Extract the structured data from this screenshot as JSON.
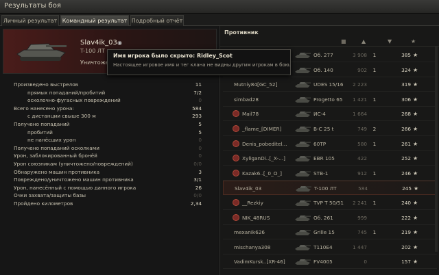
{
  "window": {
    "title": "Результаты боя"
  },
  "tabs": [
    {
      "label": "Личный результат"
    },
    {
      "label": "Командный результат"
    },
    {
      "label": "Подробный отчёт"
    }
  ],
  "player": {
    "name": "Slav4ik_03",
    "vehicle": "T-100 ЛТ",
    "status": "Уничтожен"
  },
  "tooltip": {
    "title": "Имя игрока было скрыто: Ridley_Scot",
    "body": "Настоящее игровое имя и тег клана не видны другим игрокам в бою."
  },
  "stats": [
    {
      "label": "Произведено выстрелов",
      "value": "11"
    },
    {
      "label": "прямых попаданий/пробитий",
      "value": "7/2"
    },
    {
      "label": "осколочно-фугасных повреждений",
      "value": "0"
    },
    {
      "label": "Всего нанесено урона:",
      "value": "584"
    },
    {
      "label": "с дистанции свыше 300 м",
      "value": "293"
    },
    {
      "label": "Получено попаданий",
      "value": "5"
    },
    {
      "label": "пробитий",
      "value": "5"
    },
    {
      "label": "не нанёсших урон",
      "value": "0"
    },
    {
      "label": "Получено попаданий осколками",
      "value": "0"
    },
    {
      "label": "Урон, заблокированный бронёй",
      "value": "0"
    },
    {
      "label": "Урон союзникам (уничтожено/повреждений)",
      "value": "0/0"
    },
    {
      "label": "Обнаружено машин противника",
      "value": "3"
    },
    {
      "label": "Повреждено/уничтожено машин противника",
      "value": "3/1"
    },
    {
      "label": "Урон, нанесённый с помощью данного игрока",
      "value": "26"
    },
    {
      "label": "Очки захвата/защиты базы",
      "value": "0/0"
    },
    {
      "label": "Пройдено километров",
      "value": "2,34"
    }
  ],
  "enemies": {
    "header": "Противник",
    "rows": [
      {
        "name": "",
        "vehicle": "Об. 277",
        "damage": "3 908",
        "kills": "1",
        "xp": "385",
        "icon": false
      },
      {
        "name": "",
        "vehicle": "Об. 140",
        "damage": "902",
        "kills": "1",
        "xp": "324",
        "icon": false
      },
      {
        "name": "Mutniy84[GC_52]",
        "vehicle": "UDES 15/16",
        "damage": "2 223",
        "kills": "",
        "xp": "319",
        "icon": false
      },
      {
        "name": "simbad28",
        "vehicle": "Progetto 65",
        "damage": "1 421",
        "kills": "1",
        "xp": "306",
        "icon": false
      },
      {
        "name": "Mail78",
        "vehicle": "ИС-4",
        "damage": "1 664",
        "kills": "",
        "xp": "268",
        "icon": true
      },
      {
        "name": "_flame_[DIMER]",
        "vehicle": "B-C 25 t",
        "damage": "749",
        "kills": "2",
        "xp": "266",
        "icon": true
      },
      {
        "name": "Denis_pobeditel...",
        "vehicle": "60TP",
        "damage": "580",
        "kills": "1",
        "xp": "261",
        "icon": true
      },
      {
        "name": "XyliganDi..[_X-...]",
        "vehicle": "EBR 105",
        "damage": "422",
        "kills": "",
        "xp": "252",
        "icon": true
      },
      {
        "name": "Kazak6..[_0_O_]",
        "vehicle": "STB-1",
        "damage": "912",
        "kills": "1",
        "xp": "246",
        "icon": true
      },
      {
        "name": "Slav4ik_03",
        "vehicle": "T-100 ЛТ",
        "damage": "584",
        "kills": "",
        "xp": "245",
        "icon": false,
        "self": true
      },
      {
        "name": "__Rezkiy",
        "vehicle": "TVP T 50/51",
        "damage": "2 241",
        "kills": "1",
        "xp": "240",
        "icon": true
      },
      {
        "name": "NIK_48RUS",
        "vehicle": "Об. 261",
        "damage": "999",
        "kills": "",
        "xp": "222",
        "icon": true
      },
      {
        "name": "mexanik626",
        "vehicle": "Grille 15",
        "damage": "745",
        "kills": "1",
        "xp": "219",
        "icon": false
      },
      {
        "name": "mischanya308",
        "vehicle": "T110E4",
        "damage": "1 447",
        "kills": "",
        "xp": "202",
        "icon": false
      },
      {
        "name": "VadimKursk..[XR-46]",
        "vehicle": "FV4005",
        "damage": "0",
        "kills": "",
        "xp": "157",
        "icon": false
      }
    ]
  },
  "icons": {
    "star": "★",
    "eye": "eye-icon",
    "clan": "clan-emblem-icon"
  },
  "colors": {
    "accent_red": "#7a2a26",
    "text_main": "#c8c2b0"
  }
}
